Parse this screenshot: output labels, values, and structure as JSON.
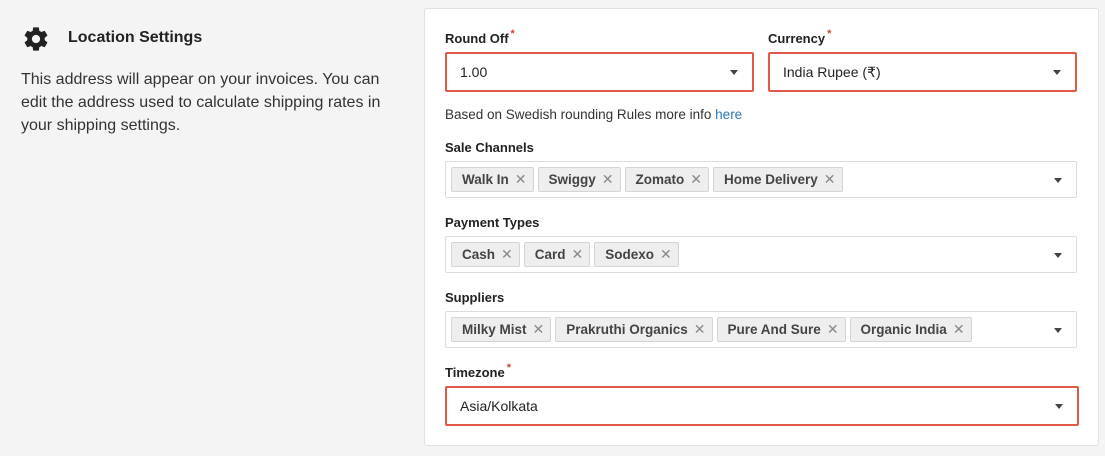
{
  "section": {
    "title": "Location Settings",
    "icon": "gear-icon",
    "description": "This address will appear on your invoices. You can edit the address used to calculate shipping rates in your shipping settings."
  },
  "round_off": {
    "label": "Round Off",
    "required": "*",
    "value": "1.00"
  },
  "currency": {
    "label": "Currency",
    "required": "*",
    "value": "India Rupee (₹)"
  },
  "helper": {
    "text": "Based on Swedish rounding Rules more info ",
    "link": "here"
  },
  "sale_channels": {
    "label": "Sale Channels",
    "chips": [
      "Walk In",
      "Swiggy",
      "Zomato",
      "Home Delivery"
    ]
  },
  "payment_types": {
    "label": "Payment Types",
    "chips": [
      "Cash",
      "Card",
      "Sodexo"
    ]
  },
  "suppliers": {
    "label": "Suppliers",
    "chips": [
      "Milky Mist",
      "Prakruthi Organics",
      "Pure And Sure",
      "Organic India"
    ]
  },
  "timezone": {
    "label": "Timezone",
    "required": "*",
    "value": "Asia/Kolkata"
  },
  "remove_glyph": "✕",
  "colors": {
    "accent_border": "#e15a48",
    "link": "#2a7bb8",
    "required": "#d64235"
  }
}
